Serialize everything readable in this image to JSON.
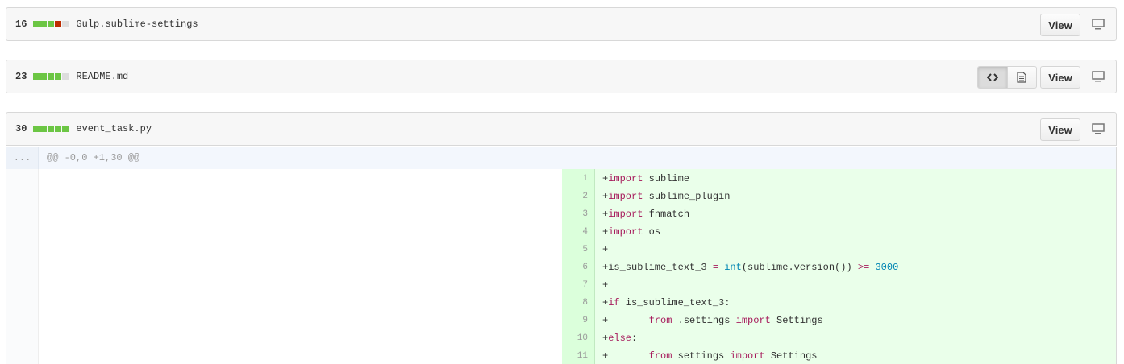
{
  "files": [
    {
      "count": "16",
      "name": "Gulp.sublime-settings",
      "stat": [
        "add",
        "add",
        "add",
        "del",
        "neutral"
      ],
      "view_label": "View"
    },
    {
      "count": "23",
      "name": "README.md",
      "stat": [
        "add",
        "add",
        "add",
        "add",
        "neutral"
      ],
      "view_label": "View"
    },
    {
      "count": "30",
      "name": "event_task.py",
      "stat": [
        "add",
        "add",
        "add",
        "add",
        "add"
      ],
      "view_label": "View"
    }
  ],
  "hunk": {
    "dots": "...",
    "header": "@@ -0,0 +1,30 @@"
  },
  "lines": [
    {
      "n": "1",
      "segs": [
        [
          "p",
          "+"
        ],
        [
          "kw",
          "import"
        ],
        [
          "p",
          " sublime"
        ]
      ]
    },
    {
      "n": "2",
      "segs": [
        [
          "p",
          "+"
        ],
        [
          "kw",
          "import"
        ],
        [
          "p",
          " sublime_plugin"
        ]
      ]
    },
    {
      "n": "3",
      "segs": [
        [
          "p",
          "+"
        ],
        [
          "kw",
          "import"
        ],
        [
          "p",
          " fnmatch"
        ]
      ]
    },
    {
      "n": "4",
      "segs": [
        [
          "p",
          "+"
        ],
        [
          "kw",
          "import"
        ],
        [
          "p",
          " os"
        ]
      ]
    },
    {
      "n": "5",
      "segs": [
        [
          "p",
          "+"
        ]
      ]
    },
    {
      "n": "6",
      "segs": [
        [
          "p",
          "+is_sublime_text_3 "
        ],
        [
          "kw",
          "="
        ],
        [
          "p",
          " "
        ],
        [
          "bi",
          "int"
        ],
        [
          "p",
          "(sublime.version()) "
        ],
        [
          "kw",
          ">="
        ],
        [
          "p",
          " "
        ],
        [
          "num",
          "3000"
        ]
      ]
    },
    {
      "n": "7",
      "segs": [
        [
          "p",
          "+"
        ]
      ]
    },
    {
      "n": "8",
      "segs": [
        [
          "p",
          "+"
        ],
        [
          "kw",
          "if"
        ],
        [
          "p",
          " is_sublime_text_3:"
        ]
      ]
    },
    {
      "n": "9",
      "segs": [
        [
          "p",
          "+       "
        ],
        [
          "kw",
          "from"
        ],
        [
          "p",
          " .settings "
        ],
        [
          "kw",
          "import"
        ],
        [
          "p",
          " Settings"
        ]
      ]
    },
    {
      "n": "10",
      "segs": [
        [
          "p",
          "+"
        ],
        [
          "kw",
          "else"
        ],
        [
          "p",
          ":"
        ]
      ]
    },
    {
      "n": "11",
      "segs": [
        [
          "p",
          "+       "
        ],
        [
          "kw",
          "from"
        ],
        [
          "p",
          " settings "
        ],
        [
          "kw",
          "import"
        ],
        [
          "p",
          " Settings"
        ]
      ]
    }
  ]
}
